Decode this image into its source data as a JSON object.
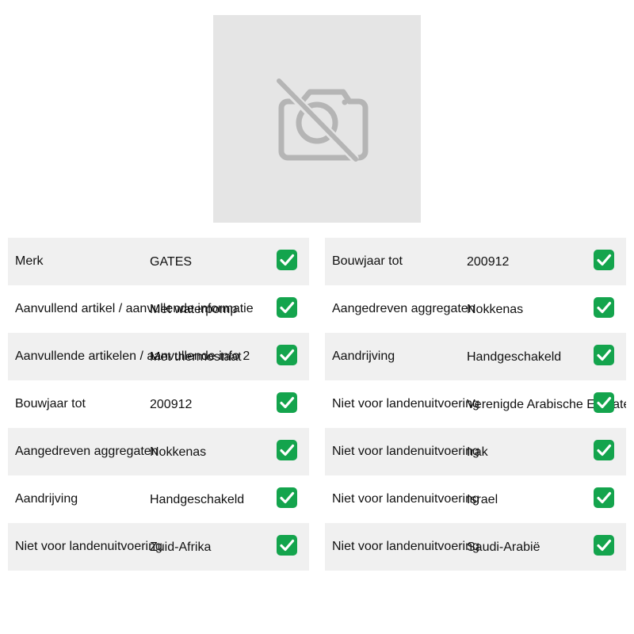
{
  "product_image": {
    "icon": "no-photo-icon"
  },
  "left_specs": [
    {
      "label": "Merk",
      "value": "GATES"
    },
    {
      "label": "Aanvullend artikel / aanvullende informatie",
      "value": "Met waterpomp"
    },
    {
      "label": "Aanvullende artikelen / aanvullende info 2",
      "value": "Met thermostaat"
    },
    {
      "label": "Bouwjaar tot",
      "value": "200912"
    },
    {
      "label": "Aangedreven aggregaten",
      "value": "Nokkenas"
    },
    {
      "label": "Aandrijving",
      "value": "Handgeschakeld"
    },
    {
      "label": "Niet voor landenuitvoering",
      "value": "Zuid-Afrika"
    }
  ],
  "right_specs": [
    {
      "label": "Bouwjaar tot",
      "value": "200912"
    },
    {
      "label": "Aangedreven aggregaten",
      "value": "Nokkenas"
    },
    {
      "label": "Aandrijving",
      "value": "Handgeschakeld"
    },
    {
      "label": "Niet voor landenuitvoering",
      "value": "Verenigde Arabische Emiraten"
    },
    {
      "label": "Niet voor landenuitvoering",
      "value": "Irak"
    },
    {
      "label": "Niet voor landenuitvoering",
      "value": "Israel"
    },
    {
      "label": "Niet voor landenuitvoering",
      "value": "Saudi-Arabië"
    }
  ],
  "check_icon": "check-mark-icon",
  "colors": {
    "row_shade": "#f0f0f0",
    "check_green": "#14a44d",
    "placeholder_bg": "#e5e5e5",
    "placeholder_icon": "#b5b5b5"
  }
}
